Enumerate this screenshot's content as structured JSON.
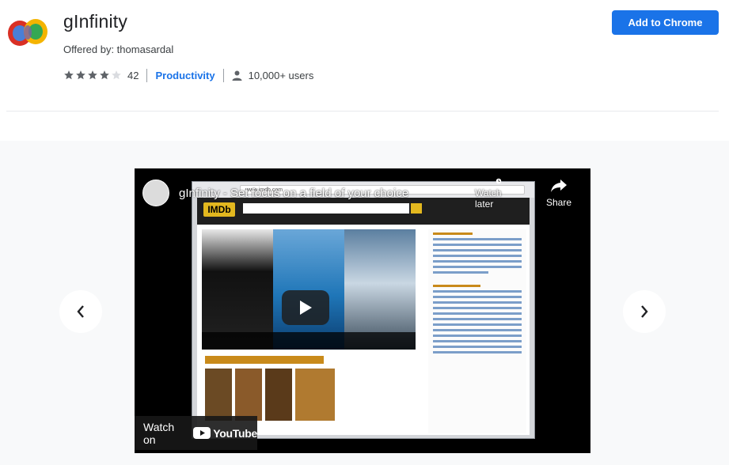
{
  "extension": {
    "name": "gInfinity",
    "offered_by": "Offered by: thomasardal",
    "rating": 4,
    "rating_max": 5,
    "rating_count": "42",
    "category": "Productivity",
    "users": "10,000+ users",
    "add_button": "Add to Chrome"
  },
  "video": {
    "title": "gInfinity - Set focus on a field of your choice",
    "watch_later_label": "Watch later",
    "share_label": "Share",
    "watch_on_label": "Watch on",
    "youtube_label": "YouTube",
    "embedded_url": "www.imdb.com"
  },
  "icons": {
    "extension": "ginfinity-logo-icon",
    "star": "star-icon",
    "users": "person-icon",
    "prev": "chevron-left-icon",
    "next": "chevron-right-icon",
    "play": "play-icon",
    "watch_later": "clock-icon",
    "share": "share-icon"
  },
  "colors": {
    "accent": "#1a73e8",
    "star_filled": "#5f6368",
    "star_empty": "#dadce0"
  }
}
